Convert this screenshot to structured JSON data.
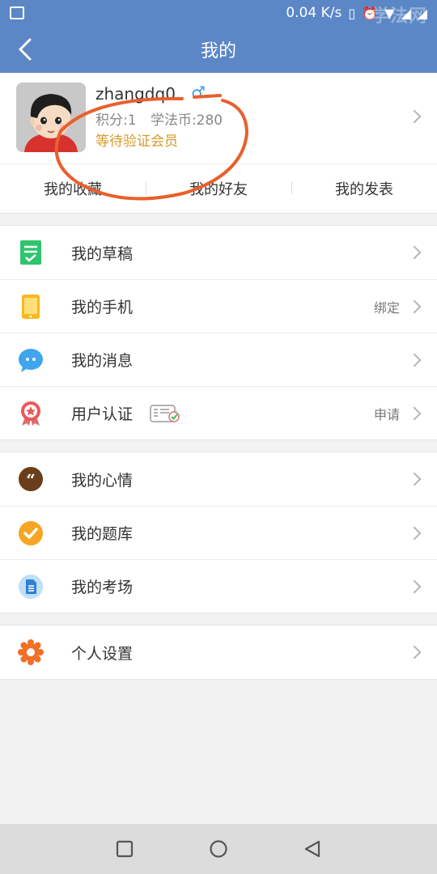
{
  "status_bar": {
    "speed": "0.04 K/s",
    "watermark": "学法网"
  },
  "header": {
    "title": "我的"
  },
  "profile": {
    "username": "zhangdq0",
    "gender_symbol": "♂",
    "points_label": "积分:1",
    "coins_label": "学法币:280",
    "member_status": "等待验证会员"
  },
  "tabs": [
    {
      "label": "我的收藏"
    },
    {
      "label": "我的好友"
    },
    {
      "label": "我的发表"
    }
  ],
  "menu_group1": [
    {
      "label": "我的草稿",
      "value": "",
      "icon": "draft-icon"
    },
    {
      "label": "我的手机",
      "value": "绑定",
      "icon": "phone-icon"
    },
    {
      "label": "我的消息",
      "value": "",
      "icon": "message-icon"
    },
    {
      "label": "用户认证",
      "value": "申请",
      "icon": "certification-icon"
    }
  ],
  "menu_group2": [
    {
      "label": "我的心情",
      "value": "",
      "icon": "mood-icon"
    },
    {
      "label": "我的题库",
      "value": "",
      "icon": "question-bank-icon"
    },
    {
      "label": "我的考场",
      "value": "",
      "icon": "exam-room-icon"
    }
  ],
  "menu_group3": [
    {
      "label": "个人设置",
      "value": "",
      "icon": "settings-icon"
    }
  ],
  "colors": {
    "primary": "#5b87c6",
    "member": "#d59a2b",
    "annotation": "#e8602c"
  }
}
